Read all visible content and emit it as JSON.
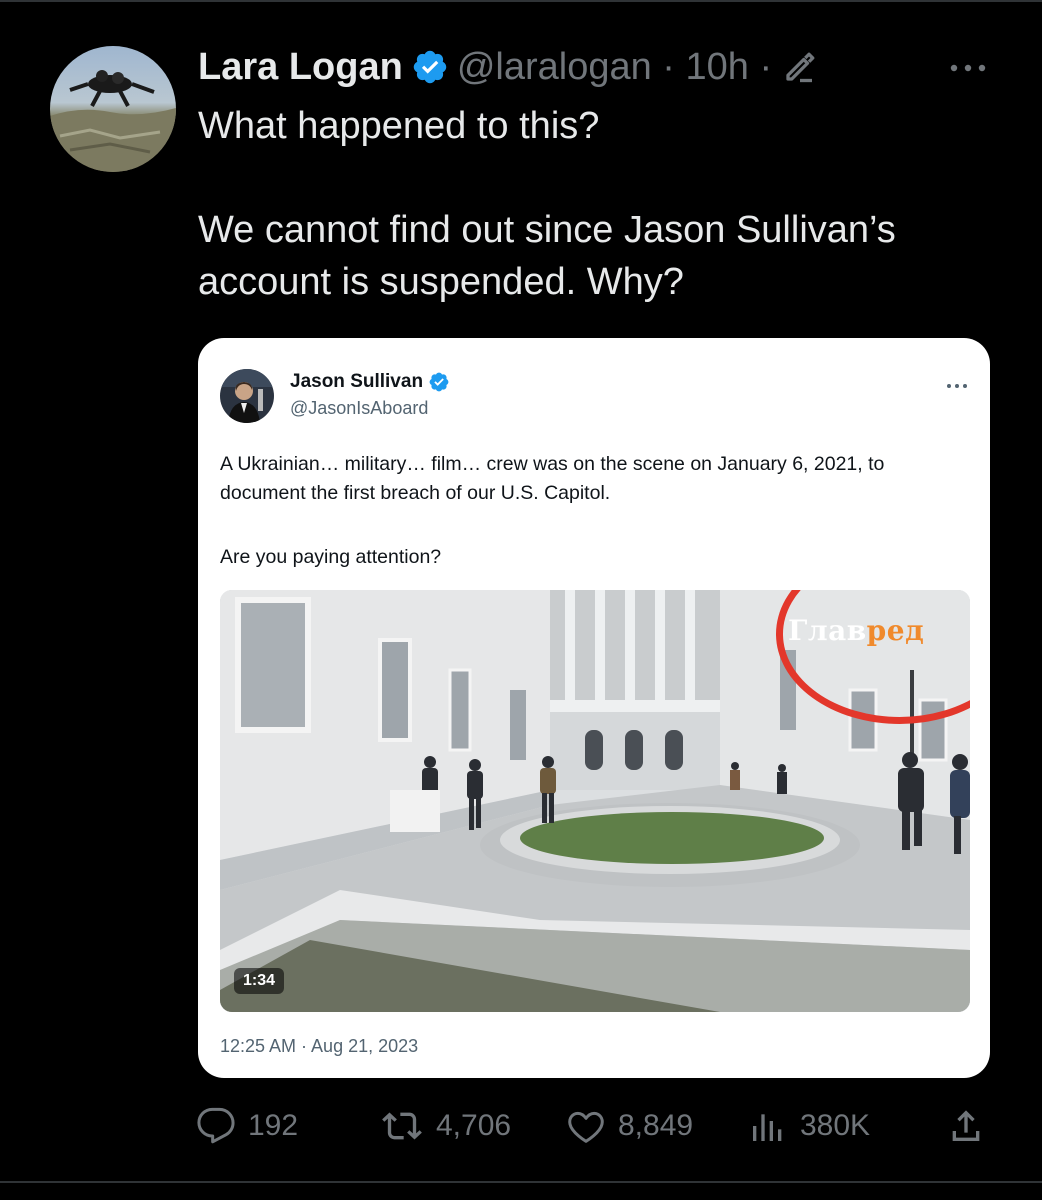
{
  "tweet": {
    "author_name": "Lara Logan",
    "handle_meta": "@laralogan · 10h ·",
    "text_line1": "What happened to this?",
    "text_line2": "We cannot find out since Jason Sullivan’s account is suspended. Why?"
  },
  "quoted": {
    "author_name": "Jason Sullivan",
    "handle": "@JasonIsAboard",
    "text_line1": "A Ukrainian… military… film… crew was on the scene on January 6, 2021, to document the first breach of our U.S. Capitol.",
    "text_line2": "Are you paying attention?",
    "video": {
      "duration": "1:34",
      "watermark_part1": "Глав",
      "watermark_part2": "ред"
    },
    "timestamp": "12:25 AM · Aug 21, 2023"
  },
  "actions": {
    "replies": "192",
    "reposts": "4,706",
    "likes": "8,849",
    "views": "380K"
  },
  "colors": {
    "background": "#000000",
    "verified": "#1d9bf0",
    "muted": "#71767b",
    "highlight_circle": "#e3372b",
    "watermark_accent": "#f08a2c"
  },
  "icons": [
    "verified-badge-icon",
    "edit-pencil-icon",
    "more-icon",
    "reply-icon",
    "repost-icon",
    "like-icon",
    "views-icon",
    "share-icon"
  ]
}
